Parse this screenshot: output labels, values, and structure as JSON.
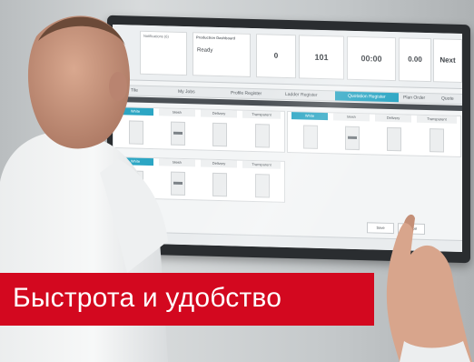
{
  "caption": {
    "text": "Быстрота и удобство",
    "background_color": "#d3081f",
    "text_color": "#ffffff"
  },
  "screen": {
    "accent_color": "#2ca6c4",
    "topbar": {
      "notifications_label": "Notifications (6)",
      "production_label": "Production Dashboard",
      "production_value": "Ready",
      "tiles": [
        {
          "label": "",
          "value": "0"
        },
        {
          "label": "",
          "value": "101"
        },
        {
          "label": "",
          "value": "00:00"
        },
        {
          "label": "",
          "value": "0.00"
        },
        {
          "label": "",
          "value": "Next"
        }
      ]
    },
    "nav": {
      "items": [
        "Tile",
        "My Jobs",
        "Profile Register",
        "Ladder Register",
        "Quotation Register",
        "Plan Order",
        "Quote"
      ],
      "active_index": 4
    },
    "panels": {
      "column_tabs": [
        "White",
        "Mesh",
        "Delivery",
        "Transparent"
      ]
    },
    "buttons": {
      "save": "Save",
      "cancel": "Cancel"
    }
  }
}
